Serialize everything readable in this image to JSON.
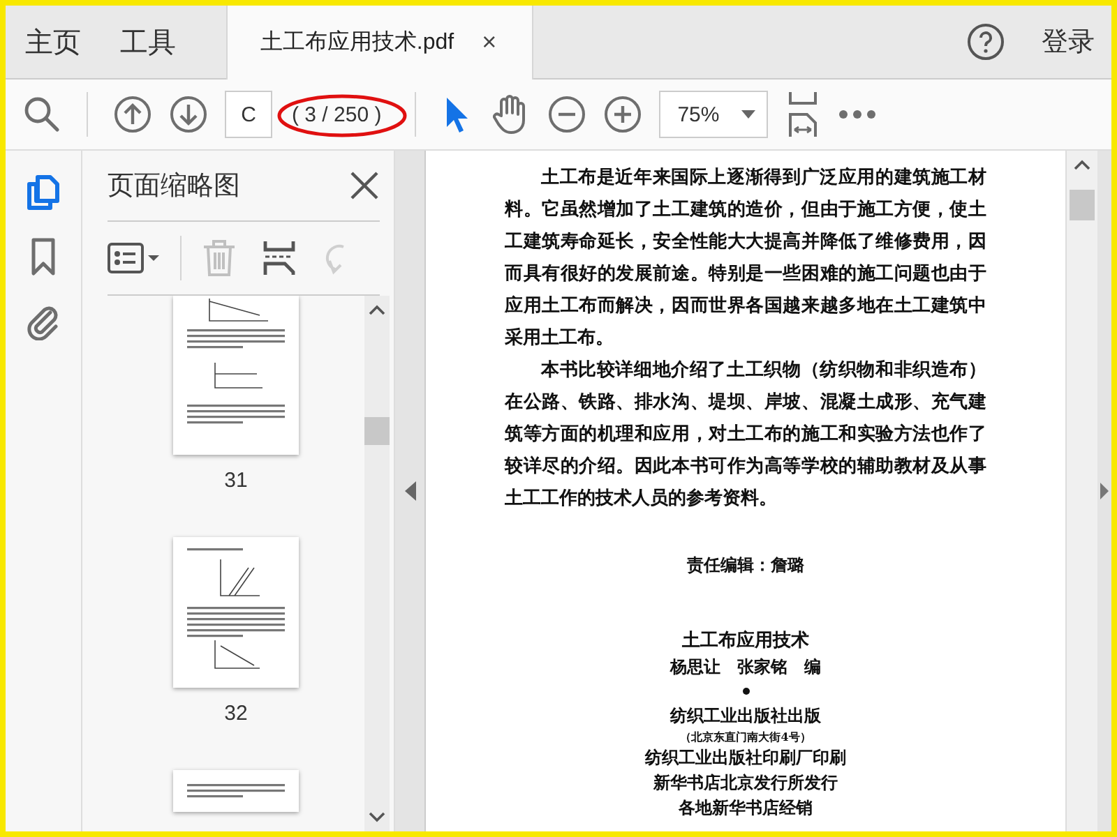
{
  "top_tabs": [
    {
      "label": "主页",
      "selected": false
    },
    {
      "label": "工具",
      "selected": false
    }
  ],
  "document_tab": {
    "title": "土工布应用技术.pdf",
    "close": "×"
  },
  "account": {
    "sign_in": "登录"
  },
  "toolbar": {
    "page_input": "C",
    "page_count": "( 3 / 250 )",
    "page_count_circled": true,
    "zoom": "75%",
    "tools": [
      {
        "kind": "select",
        "selected": true
      },
      {
        "kind": "hand",
        "selected": false
      }
    ]
  },
  "rail_items": [
    {
      "kind": "thumbnails",
      "selected": true
    },
    {
      "kind": "bookmarks",
      "selected": false
    },
    {
      "kind": "attachments",
      "selected": false
    }
  ],
  "panel": {
    "title": "页面缩略图",
    "delete_disabled": true,
    "rotate_disabled": true,
    "thumbnails": [
      {
        "label": "31",
        "kind": "top-cut"
      },
      {
        "label": "32",
        "kind": "full"
      },
      {
        "kind": "bottom-cut"
      }
    ]
  },
  "document": {
    "paragraphs": [
      "土工布是近年来国际上逐渐得到广泛应用的建筑施工材料。它虽然增加了土工建筑的造价，但由于施工方便，使土工建筑寿命延长，安全性能大大提高并降低了维修费用，因而具有很好的发展前途。特别是一些困难的施工问题也由于应用土工布而解决，因而世界各国越来越多地在土工建筑中采用土工布。",
      "本书比较详细地介绍了土工织物（纺织物和非织造布）在公路、铁路、排水沟、堤坝、岸坡、混凝土成形、充气建筑等方面的机理和应用，对土工布的施工和实验方法也作了较详尽的介绍。因此本书可作为高等学校的辅助教材及从事土工工作的技术人员的参考资料。"
    ],
    "editor": "责任编辑：詹璐",
    "book_title": "土工布应用技术",
    "authors": "杨思让　张家铭　编",
    "imprint": [
      {
        "text": "纺织工业出版社出版",
        "kind": "normal"
      },
      {
        "text": "（北京东直门南大街4号）",
        "kind": "small"
      },
      {
        "text": "纺织工业出版社印刷厂印刷",
        "kind": "normal"
      },
      {
        "text": "新华书店北京发行所发行",
        "kind": "normal"
      },
      {
        "text": "各地新华书店经销",
        "kind": "normal"
      }
    ]
  }
}
